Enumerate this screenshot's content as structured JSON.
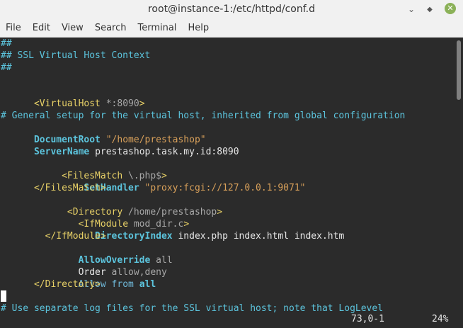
{
  "window": {
    "title": "root@instance-1:/etc/httpd/conf.d"
  },
  "menu": [
    "File",
    "Edit",
    "View",
    "Search",
    "Terminal",
    "Help"
  ],
  "lines": {
    "l1": "##",
    "l2": "## SSL Virtual Host Context",
    "l3": "##",
    "l5_tag_open": "<VirtualHost ",
    "l5_arg": "*:8090",
    "l5_close": ">",
    "l7": "# General setup for the virtual host, inherited from global configuration",
    "l8_dir": "DocumentRoot",
    "l8_val": "\"/home/prestashop\"",
    "l9_dir": "ServerName",
    "l9_val": " prestashop.task.my.id:8090",
    "l11_tag": "     <FilesMatch ",
    "l11_arg": "\\.php$",
    "l11_close": ">",
    "l12_dir": "         SetHandler",
    "l12_val": " \"proxy:fcgi://127.0.0.1:9071\"",
    "l13": "      </FilesMatch>",
    "l14_tag": "      <Directory ",
    "l14_arg": "/home/prestashop",
    "l14_close": ">",
    "l15_tag": "        <IfModule ",
    "l15_arg": "mod_dir.c",
    "l15_close": ">",
    "l16_dir": "           DirectoryIndex",
    "l16_val": " index.php index.html index.htm",
    "l17": "        </IfModule>",
    "l18_dir": "        AllowOverride",
    "l18_val": " all",
    "l19_dir": "        Order",
    "l19_val": " allow,deny",
    "l20_a": "        Allow ",
    "l20_b": "from ",
    "l20_c": "all",
    "l21": "      </Directory>",
    "l24": "# Use separate log files for the SSL virtual host; note that LogLevel"
  },
  "status": {
    "position": "73,0-1",
    "percent": "24%"
  }
}
